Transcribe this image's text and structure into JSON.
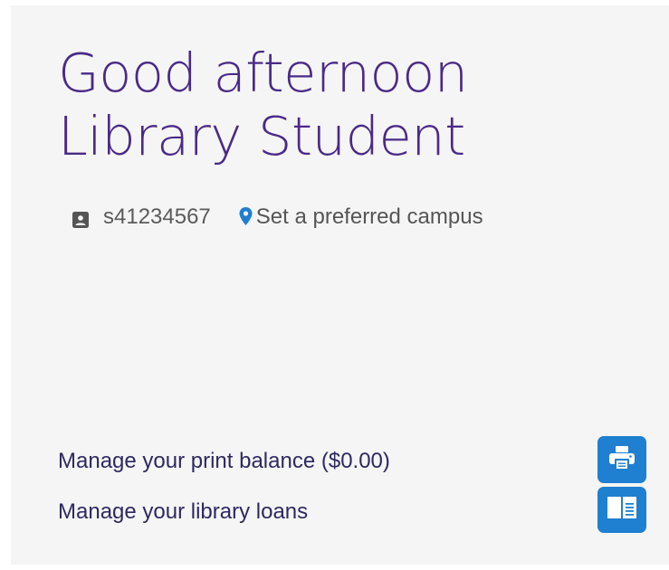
{
  "greeting": {
    "line1": "Good afternoon",
    "line2": "Library Student"
  },
  "user": {
    "id_icon": "badge-icon",
    "student_id": "s41234567",
    "campus_icon": "location-pin-icon",
    "campus_link": "Set a preferred campus"
  },
  "actions": [
    {
      "label": "Manage your print balance ($0.00)",
      "icon": "printer-icon"
    },
    {
      "label": "Manage your library loans",
      "icon": "open-book-icon"
    }
  ],
  "colors": {
    "greeting": "#4a2a87",
    "link": "#2e2960",
    "accent": "#1f7fd0",
    "card_bg": "#f5f5f5"
  }
}
